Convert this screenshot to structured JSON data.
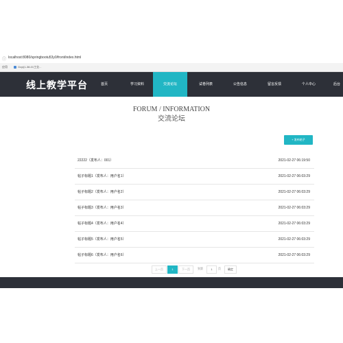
{
  "browser": {
    "url": "localhost:8080/springbootu53y0/front/index.html",
    "bookmarks_apps": "应用",
    "bookmark_item": "Gxyl(1-38-01工业..."
  },
  "nav": {
    "logo": "线上教学平台",
    "items": [
      {
        "label": "首页"
      },
      {
        "label": "学习资料"
      },
      {
        "label": "交流论坛",
        "active": true
      },
      {
        "label": "试卷列表"
      },
      {
        "label": "公告信息"
      },
      {
        "label": "留言反馈"
      },
      {
        "label": "个人中心"
      },
      {
        "label": "后台"
      }
    ]
  },
  "page": {
    "title_en": "FORUM / INFORMATION",
    "title_zh": "交流论坛",
    "post_button": "发布帖子",
    "post_button_icon": "plus-icon"
  },
  "posts": [
    {
      "title": "22222（发布人：001）",
      "time": "2021-02-27 06:19:50"
    },
    {
      "title": "帖子标题1（发布人：用户名1）",
      "time": "2021-02-27 06:03:29"
    },
    {
      "title": "帖子标题2（发布人：用户名2）",
      "time": "2021-02-27 06:03:29"
    },
    {
      "title": "帖子标题3（发布人：用户名3）",
      "time": "2021-02-27 06:03:29"
    },
    {
      "title": "帖子标题4（发布人：用户名4）",
      "time": "2021-02-27 06:03:29"
    },
    {
      "title": "帖子标题5（发布人：用户名5）",
      "time": "2021-02-27 06:03:29"
    },
    {
      "title": "帖子标题6（发布人：用户名6）",
      "time": "2021-02-27 06:03:29"
    }
  ],
  "pager": {
    "prev": "上一页",
    "current": "1",
    "next": "下一页",
    "goto_label": "到第",
    "page_input": "1",
    "page_unit": "页",
    "confirm": "确定"
  },
  "colors": {
    "accent": "#21b6c4",
    "nav_bg": "#2d3038"
  }
}
